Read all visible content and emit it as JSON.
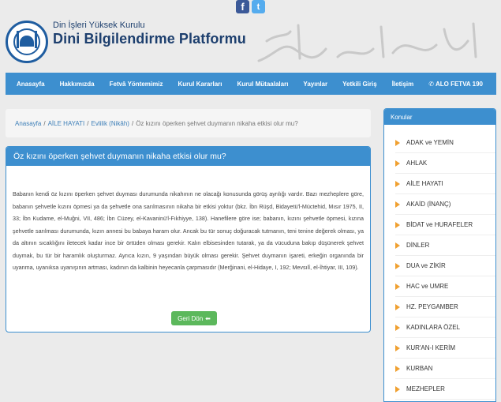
{
  "social": {
    "facebook": "f",
    "twitter": "t"
  },
  "header": {
    "subtitle": "Din İşleri Yüksek Kurulu",
    "title": "Dini Bilgilendirme Platformu"
  },
  "nav": [
    "Anasayfa",
    "Hakkımızda",
    "Fetvâ Yöntemimiz",
    "Kurul Kararları",
    "Kurul Mütaalaları",
    "Yayınlar",
    "Yetkili Giriş",
    "İletişim",
    "ALO FETVA 190"
  ],
  "breadcrumb": {
    "home": "Anasayfa",
    "cat": "AİLE HAYATI",
    "sub": "Evlilik (Nikâh)",
    "current": "Öz kızını öperken şehvet duymanın nikaha etkisi olur mu?"
  },
  "article": {
    "title": "Öz kızını öperken şehvet duymanın nikaha etkisi olur mu?",
    "body": "Babanın kendi öz kızını öperken şehvet duyması durumunda nikahının ne olacağı konusunda görüş ayrılığı vardır. Bazı mezheplere göre, babanın şehvetle kızını öpmesi ya da şehvetle ona sarılmasının nikaha bir etkisi yoktur (bkz. İbn Rüşd, Bidayetü'l-Müctehid, Mısır 1975, II, 33; İbn Kudame, el-Muğni, VII, 486; İbn Cüzey, el-Kavaninü'l-Fıkhiyye, 138). Hanefilere göre ise; babanın, kızını şehvetle öpmesi, kızına şehvetle sarılması durumunda, kızın annesi bu babaya haram olur. Ancak bu tür sonuç doğuracak tutmanın, teni tenine değerek olması, ya da altının sıcaklığını iletecek kadar ince bir örtüden olması gerekir. Kalın elbisesinden tutarak, ya da vücuduna bakıp düşünerek şehvet duymak, bu tür bir haramlık oluşturmaz. Ayrıca kızın, 9 yaşından büyük olması gerekir. Şehvet duymanın işareti, erkeğin organında bir uyanma, uyanıksa uyanışının artması, kadının da kalbinin heyecanla çarpmasıdır (Merğinani, el-Hidaye, I, 192; Mevsılî, el-İhtiyar, III, 109).",
    "back_label": "Geri Dön"
  },
  "sidebar": {
    "title": "Konular",
    "items": [
      "ADAK ve YEMİN",
      "AHLAK",
      "AİLE HAYATI",
      "AKAİD (İNANÇ)",
      "BİDAT ve HURAFELER",
      "DİNLER",
      "DUA ve ZİKİR",
      "HAC ve UMRE",
      "HZ. PEYGAMBER",
      "KADINLARA ÖZEL",
      "KUR'AN-I KERİM",
      "KURBAN",
      "MEZHEPLER"
    ]
  },
  "colors": {
    "primary": "#3d8fcf",
    "accent": "#f0a030",
    "button": "#5cb85c",
    "brand": "#1d3f6e"
  }
}
